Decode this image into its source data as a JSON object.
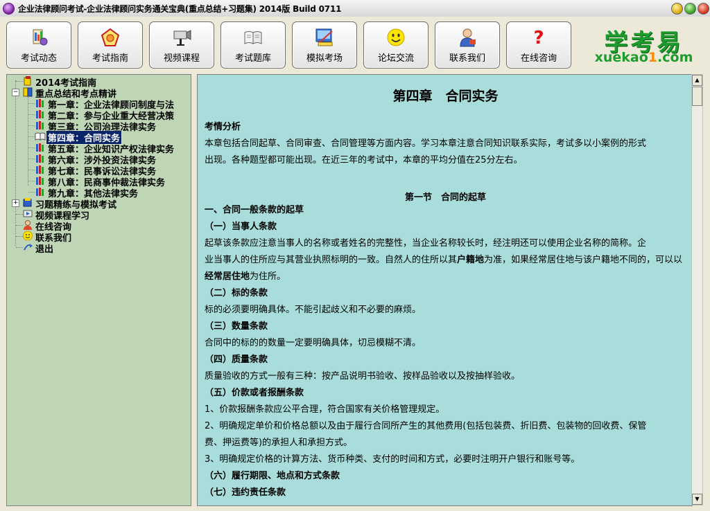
{
  "window": {
    "title": "企业法律顾问考试-企业法律顾问实务通关宝典(重点总结+习题集) 2014版 Build 0711"
  },
  "toolbar": {
    "buttons": [
      {
        "label": "考试动态",
        "icon": "exam-news-icon"
      },
      {
        "label": "考试指南",
        "icon": "exam-guide-icon"
      },
      {
        "label": "视频课程",
        "icon": "video-course-icon"
      },
      {
        "label": "考试题库",
        "icon": "question-bank-icon"
      },
      {
        "label": "模拟考场",
        "icon": "mock-exam-icon"
      },
      {
        "label": "论坛交流",
        "icon": "forum-smiley-icon"
      },
      {
        "label": "联系我们",
        "icon": "contact-person-icon"
      },
      {
        "label": "在线咨询",
        "icon": "question-mark-icon"
      }
    ],
    "logo": {
      "cn": "学考易",
      "en_a": "xuekao",
      "en_b": "1",
      "en_c": ".com"
    }
  },
  "tree": {
    "nodes": [
      {
        "label": "2014考试指南",
        "level": 0
      },
      {
        "label": "重点总结和考点精讲",
        "level": 0,
        "expanded": true
      },
      {
        "label": "第一章：企业法律顾问制度与法",
        "level": 1
      },
      {
        "label": "第二章：参与企业重大经营决策",
        "level": 1
      },
      {
        "label": "第三章：公司治理法律实务",
        "level": 1
      },
      {
        "label": "第四章：合同实务",
        "level": 1,
        "selected": true
      },
      {
        "label": "第五章：企业知识产权法律实务",
        "level": 1
      },
      {
        "label": "第六章：涉外投资法律实务",
        "level": 1
      },
      {
        "label": "第七章：民事诉讼法律实务",
        "level": 1
      },
      {
        "label": "第八章：民商事仲裁法律实务",
        "level": 1
      },
      {
        "label": "第九章：其他法律实务",
        "level": 1
      },
      {
        "label": "习题精练与模拟考试",
        "level": 0,
        "expanded": false
      },
      {
        "label": "视频课程学习",
        "level": 0
      },
      {
        "label": "在线咨询",
        "level": 0
      },
      {
        "label": "联系我们",
        "level": 0
      },
      {
        "label": "退出",
        "level": 0
      }
    ]
  },
  "content": {
    "chapter_title": "第四章　合同实务",
    "analysis_heading": "考情分析",
    "analysis_text_1": "本章包括合同起草、合同审查、合同管理等方面内容。学习本章注意合同知识联系实际，考试多以小案例的形式",
    "analysis_text_2": "出现。各种题型都可能出现。在近三年的考试中，本章的平均分值在25分左右。",
    "section_title": "第一节　合同的起草",
    "h1": "一、合同一般条款的起草",
    "h1_1": "（一）当事人条款",
    "p1_1a": "起草该条款应注意当事人的名称或者姓名的完整性，当企业名称较长时，经注明还可以使用企业名称的简称。企",
    "p1_1b_pre": "业当事人的住所应与其营业执照标明的一致。自然人的住所以其",
    "p1_1b_bold": "户籍地",
    "p1_1b_post": "为准，如果经常居住地与该户籍地不同的，可以以",
    "p1_1c_bold": "经常居住地",
    "p1_1c_post": "为住所。",
    "h1_2": "（二）标的条款",
    "p1_2": "标的必须要明确具体。不能引起歧义和不必要的麻烦。",
    "h1_3": "（三）数量条款",
    "p1_3": "合同中的标的的数量一定要明确具体，切忌模糊不清。",
    "h1_4": "（四）质量条款",
    "p1_4": "质量验收的方式一般有三种：按产品说明书验收、按样品验收以及按抽样验收。",
    "h1_5": "（五）价款或者报酬条款",
    "p1_5a": "1、价款报酬条款应公平合理，符合国家有关价格管理规定。",
    "p1_5b": "2、明确规定单价和价格总额以及由于履行合同所产生的其他费用(包括包装费、折旧费、包装物的回收费、保管",
    "p1_5c": "费、押运费等)的承担人和承担方式。",
    "p1_5d": "3、明确规定价格的计算方法、货币种类、支付的时间和方式，必要时注明开户银行和账号等。",
    "h1_6": "（六）履行期限、地点和方式条款",
    "h1_7": "（七）违约责任条款"
  },
  "colors": {
    "tree_bg": "#bfd6b6",
    "content_bg": "#a9dddb",
    "selection": "#0a246a",
    "logo_green": "#1b9c2c"
  }
}
